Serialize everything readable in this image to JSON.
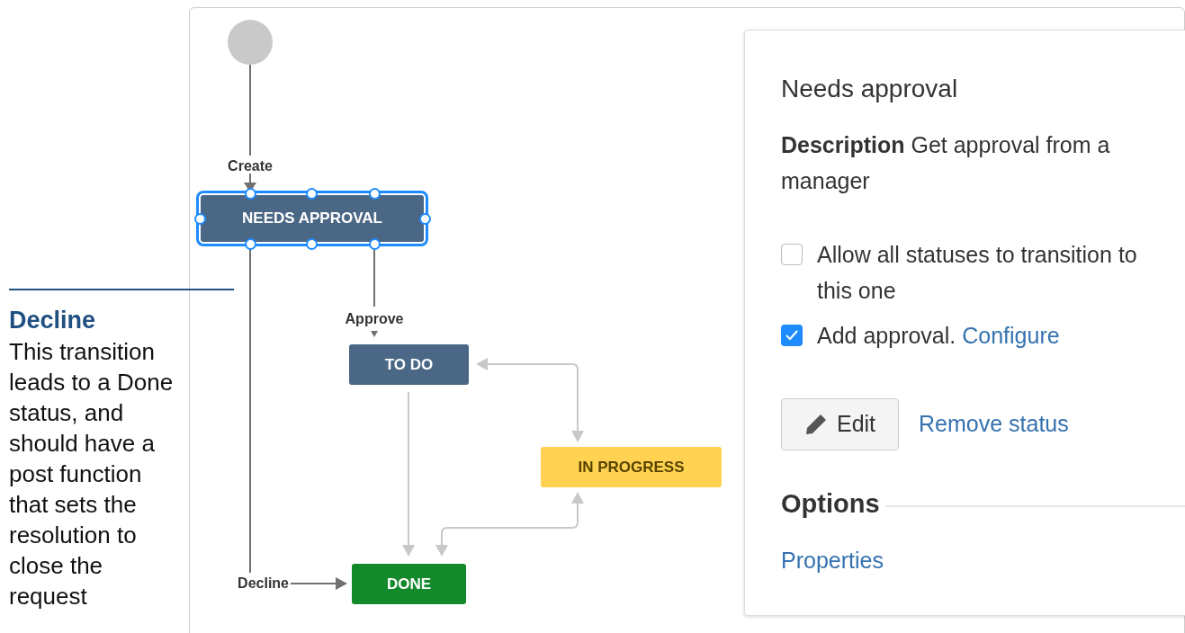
{
  "annotation": {
    "title": "Decline",
    "body": "This transition leads to a Done status, and should have a post function that sets the resolution to close the request"
  },
  "diagram": {
    "statuses": [
      {
        "label": "NEEDS APPROVAL",
        "color": "#4a6785",
        "selected": true
      },
      {
        "label": "TO DO",
        "color": "#4a6785",
        "selected": false
      },
      {
        "label": "IN PROGRESS",
        "color": "#ffd351",
        "selected": false
      },
      {
        "label": "DONE",
        "color": "#14892c",
        "selected": false
      }
    ],
    "transitions": [
      "Create",
      "Approve",
      "Decline"
    ]
  },
  "panel": {
    "title": "Needs approval",
    "description": "**Description** Get approval from a manager",
    "options": [
      {
        "label": "Allow all statuses to transition to this one",
        "checked": false
      },
      {
        "label": "Add approval.",
        "link": "Configure",
        "checked": true
      }
    ],
    "edit_button": "Edit",
    "remove_link": "Remove status",
    "section": "Options",
    "properties_link": "Properties"
  }
}
